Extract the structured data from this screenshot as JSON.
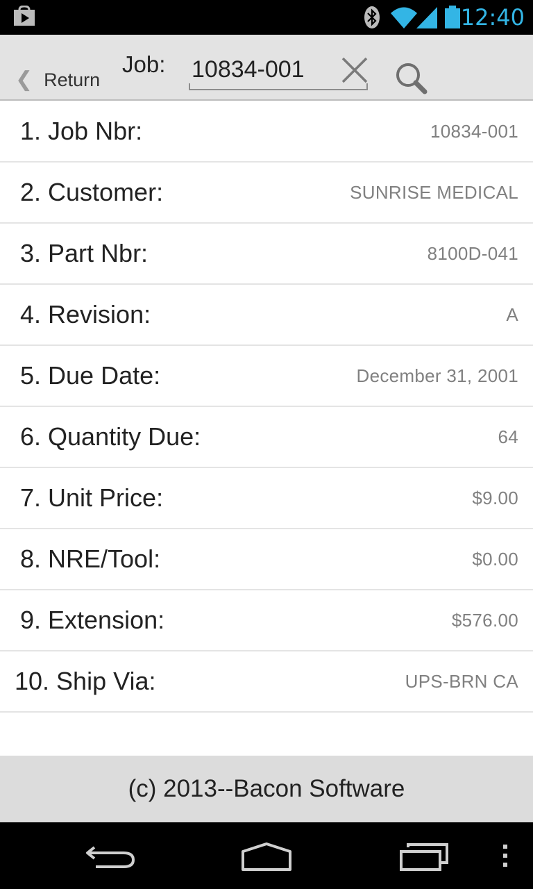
{
  "status_bar": {
    "time": "12:40",
    "icons": [
      "play-store-icon",
      "bluetooth-icon",
      "wifi-icon",
      "cell-signal-icon",
      "battery-icon"
    ],
    "clock_color": "#33b5e5"
  },
  "action_bar": {
    "return_label": "Return",
    "job_label": "Job:",
    "job_value": "10834-001",
    "icons": [
      "chevron-left-icon",
      "clear-icon",
      "search-icon"
    ]
  },
  "fields": [
    {
      "label": "1. Job Nbr:",
      "value": "10834-001"
    },
    {
      "label": "2. Customer:",
      "value": "SUNRISE MEDICAL"
    },
    {
      "label": "3. Part Nbr:",
      "value": "8100D-041"
    },
    {
      "label": "4. Revision:",
      "value": "A"
    },
    {
      "label": "5. Due Date:",
      "value": "December 31, 2001"
    },
    {
      "label": "6. Quantity Due:",
      "value": "64"
    },
    {
      "label": "7. Unit Price:",
      "value": "$9.00"
    },
    {
      "label": "8. NRE/Tool:",
      "value": "$0.00"
    },
    {
      "label": "9. Extension:",
      "value": "$576.00"
    },
    {
      "label": "10. Ship Via:",
      "value": "UPS-BRN CA"
    }
  ],
  "footer": {
    "text": "(c) 2013--Bacon Software"
  },
  "nav_bar": {
    "icons": [
      "back-icon",
      "home-icon",
      "recents-icon",
      "overflow-menu-icon"
    ]
  }
}
